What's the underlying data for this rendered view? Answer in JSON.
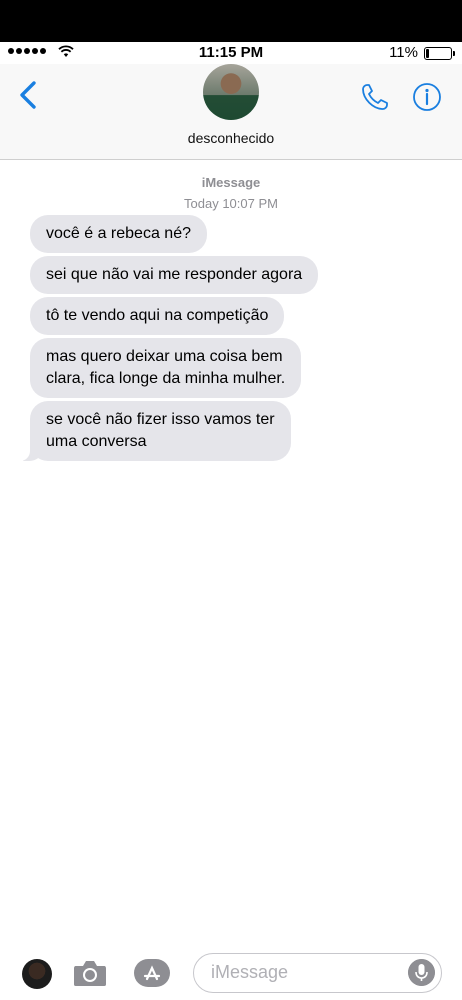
{
  "status_bar": {
    "time": "11:15 PM",
    "battery_percent": "11%",
    "battery_level": 0.11
  },
  "header": {
    "contact_name": "desconhecido"
  },
  "thread": {
    "service": "iMessage",
    "timestamp": "Today 10:07 PM",
    "messages": [
      {
        "lines": [
          "você é a rebeca né?"
        ]
      },
      {
        "lines": [
          "sei que não vai me responder agora"
        ]
      },
      {
        "lines": [
          "tô te vendo aqui na competição"
        ]
      },
      {
        "lines": [
          "mas quero deixar uma coisa bem",
          "clara, fica longe da minha mulher."
        ]
      },
      {
        "lines": [
          "se você não fizer isso vamos ter",
          "uma conversa"
        ]
      }
    ]
  },
  "input_bar": {
    "placeholder": "iMessage"
  },
  "colors": {
    "accent": "#1a7fe0",
    "bubble_incoming": "#e5e5ea",
    "meta_text": "#8e8e93"
  },
  "icons": {
    "back": "chevron-left-icon",
    "phone": "phone-icon",
    "info": "info-icon",
    "camera": "camera-icon",
    "apps": "app-store-icon",
    "mic": "microphone-icon"
  }
}
